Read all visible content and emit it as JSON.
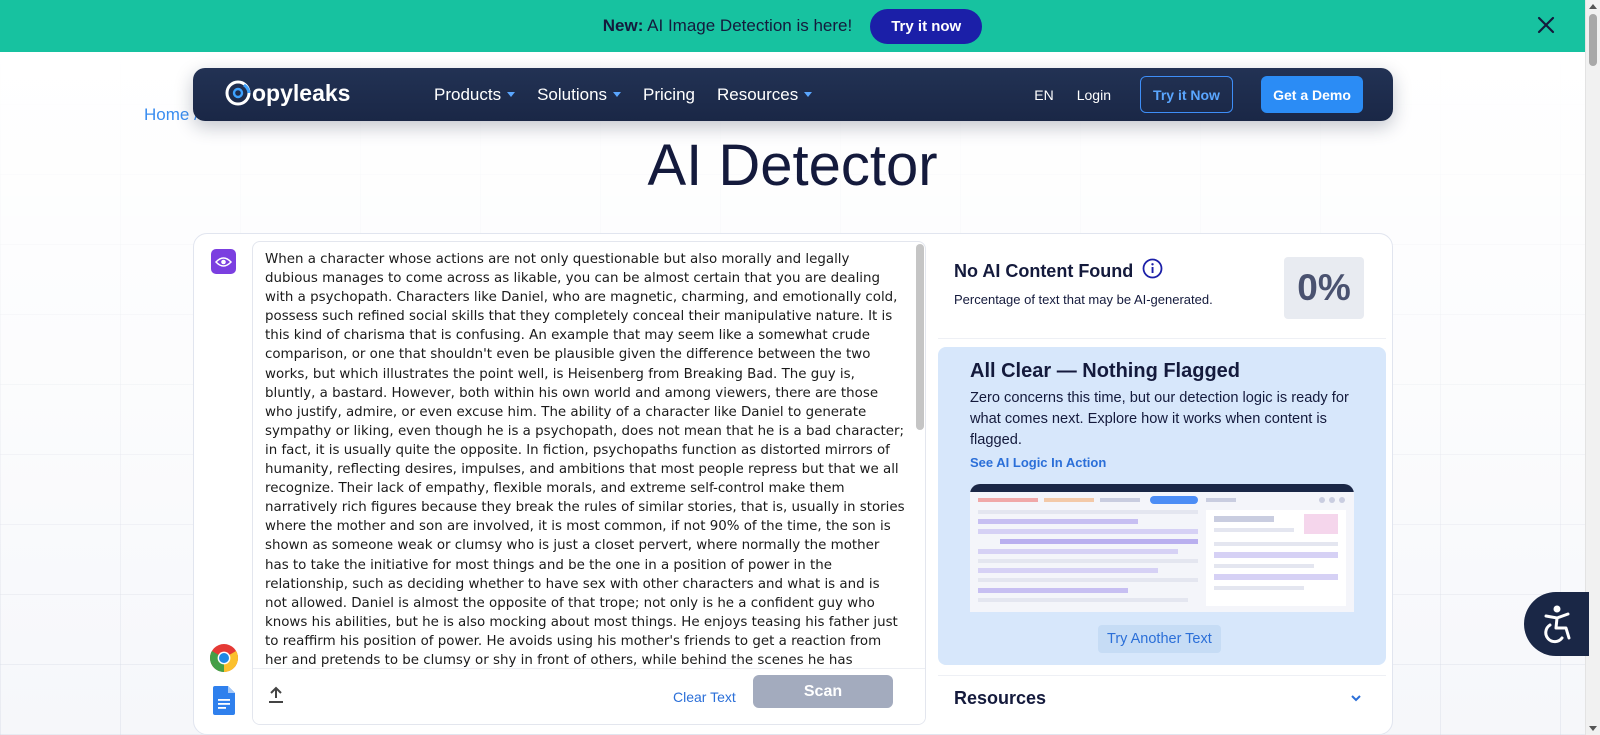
{
  "announcement": {
    "bold": "New:",
    "text": "AI Image Detection is here!",
    "button": "Try it now"
  },
  "nav": {
    "logo": "opyleaks",
    "links": [
      {
        "label": "Products",
        "dropdown": true
      },
      {
        "label": "Solutions",
        "dropdown": true
      },
      {
        "label": "Pricing",
        "dropdown": false
      },
      {
        "label": "Resources",
        "dropdown": true
      }
    ],
    "lang": "EN",
    "login": "Login",
    "try_button": "Try it Now",
    "demo_button": "Get a Demo"
  },
  "breadcrumb": "Home /",
  "page_title": "AI Detector",
  "editor": {
    "text": "When a character whose actions are not only questionable but also morally and legally dubious manages to come across as likable, you can be almost certain that you are dealing with a psychopath. Characters like Daniel, who are magnetic, charming, and emotionally cold, possess such refined social skills that they completely conceal their manipulative nature. It is this kind of charisma that is confusing. An example that may seem like a somewhat crude comparison, or one that shouldn't even be plausible given the difference between the two works, but which illustrates the point well, is Heisenberg from Breaking Bad. The guy is, bluntly, a bastard. However, both within his own world and among viewers, there are those who justify, admire, or even excuse him. The ability of a character like Daniel to generate sympathy or liking, even though he is a psychopath, does not mean that he is a bad character; in fact, it is usually quite the opposite. In fiction, psychopaths function as distorted mirrors of humanity, reflecting desires, impulses, and ambitions that most people repress but that we all recognize. Their lack of empathy, flexible morals, and extreme self-control make them narratively rich figures because they break the rules of similar stories, that is, usually in stories where the mother and son are involved, it is most common, if not 90% of the time, the son is shown as someone weak or clumsy who is just a closet pervert, where normally the mother has to take the initiative for most things and be the one in a position of power in the relationship, such as deciding whether to have sex with other characters and what is and is not allowed. Daniel is almost the opposite of that trope; not only is he a confident guy who knows his abilities, but he is also mocking about most things. He enjoys teasing his father just to reaffirm his position of power. He avoids using his mother's friends to get a reaction from her and pretends to be clumsy or shy in front of others, while behind the scenes he has another side to him that gets annoyed when interrupted",
    "clear_label": "Clear Text",
    "scan_label": "Scan"
  },
  "result": {
    "title": "No AI Content Found",
    "subtitle": "Percentage of text that may be AI-generated.",
    "percent": "0%"
  },
  "all_clear": {
    "title": "All Clear — Nothing Flagged",
    "description": "Zero concerns this time, but our detection logic is ready for what comes next. Explore how it works when content is flagged.",
    "link": "See AI Logic In Action",
    "button": "Try Another Text"
  },
  "resources": {
    "title": "Resources"
  },
  "colors": {
    "announcement_bg": "#17c2a0",
    "nav_bg": "#1a2746",
    "accent": "#2b8cf5",
    "panel_bg": "#d7e7fb"
  }
}
